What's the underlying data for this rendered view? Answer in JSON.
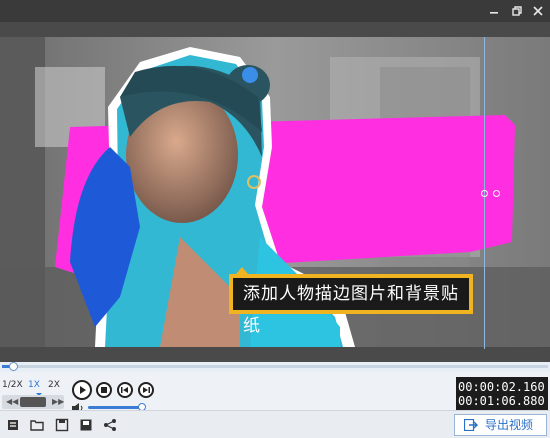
{
  "window": {
    "minimize_icon": "minimize-icon",
    "restore_icon": "restore-icon",
    "close_icon": "close-icon"
  },
  "preview": {
    "caption": "添加人物描边图片和背景贴纸",
    "accent_color": "#ff2ee0",
    "caption_border_color": "#f0b420"
  },
  "playback": {
    "progress": 0.02,
    "speeds": [
      "1/2X",
      "1X",
      "2X"
    ],
    "active_speed": "1X",
    "volume": 0.95,
    "current_time": "00:00:02.160",
    "total_time": "00:01:06.880"
  },
  "toolbar": {
    "export_label": "导出视频",
    "tools": [
      "crop-icon",
      "open-folder-icon",
      "save-icon",
      "save-as-icon",
      "share-icon"
    ]
  }
}
